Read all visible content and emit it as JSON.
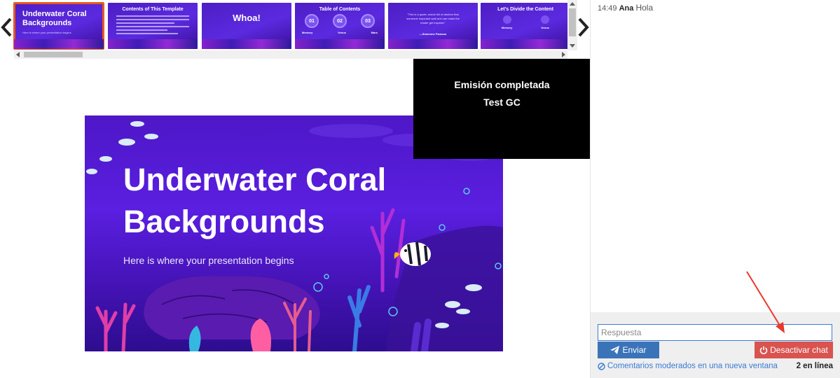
{
  "thumbnails": [
    {
      "title": "Underwater Coral Backgrounds",
      "subtitle": "Here is where your presentation begins",
      "active": true
    },
    {
      "title": "Contents of This Template"
    },
    {
      "title": "Whoa!"
    },
    {
      "title": "Table of Contents",
      "numbers": [
        "01",
        "02",
        "03"
      ],
      "labels": [
        "Memory",
        "Venus",
        "Mars"
      ]
    },
    {
      "quote": "\"This is a quote, words full of wisdom that someone important said and can make the reader get inspired.\"",
      "author": "—Someone Famous"
    },
    {
      "title": "Let's Divide the Content",
      "labels": [
        "Memory",
        "Venus"
      ]
    }
  ],
  "slide": {
    "title_line1": "Underwater Coral",
    "title_line2": "Backgrounds",
    "subtitle": "Here is where your presentation begins"
  },
  "broadcast": {
    "line1": "Emisión completada",
    "line2": "Test GC"
  },
  "chat": {
    "messages": [
      {
        "time": "14:49",
        "user": "Ana",
        "text": "Hola"
      }
    ],
    "reply_placeholder": "Respuesta",
    "send_label": "Enviar",
    "deactivate_label": "Desactivar chat",
    "moderated_link": "Comentarios moderados en una nueva ventana",
    "online_count": "2 en línea"
  },
  "colors": {
    "slide_bg": "#5a1fe0",
    "active_thumb_border": "#e8581d",
    "send_button": "#3b73b9",
    "deactivate_button": "#d9534f",
    "annotation_arrow": "#e8392b"
  }
}
